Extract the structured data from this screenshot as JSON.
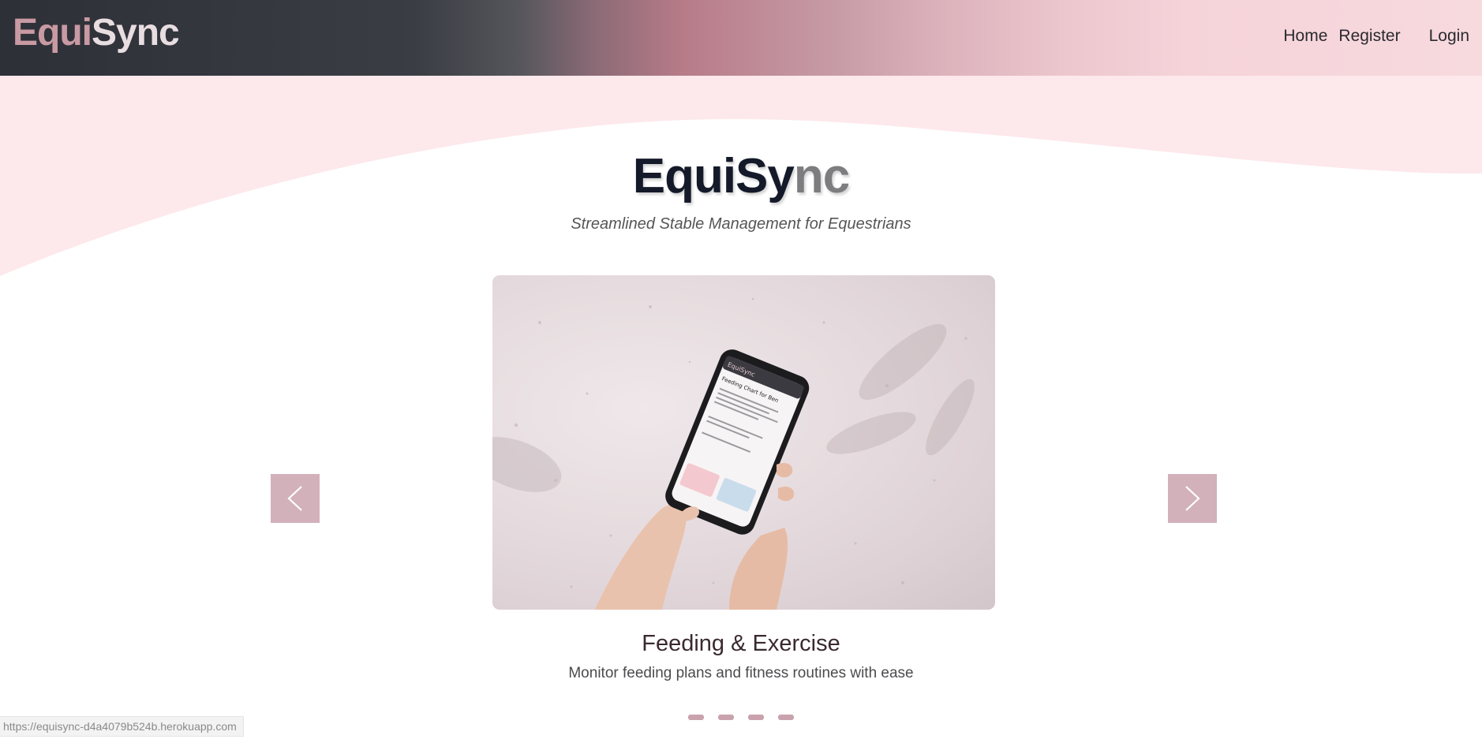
{
  "navbar": {
    "brand_part1": "Equi",
    "brand_part2": "Sync",
    "links": {
      "home": "Home",
      "register": "Register",
      "login": "Login"
    }
  },
  "hero": {
    "title_part1": "EquiSy",
    "title_part2": "nc",
    "subtitle": "Streamlined Stable Management for Equestrians"
  },
  "carousel": {
    "image_icon": "phone-in-hands-image",
    "phone_screen": {
      "brand": "EquiSync",
      "heading": "Feeding Chart for Ben"
    },
    "prev_icon": "chevron-left-icon",
    "next_icon": "chevron-right-icon",
    "slide_title": "Feeding & Exercise",
    "slide_description": "Monitor feeding plans and fitness routines with ease",
    "indicator_count": 4,
    "active_index": 0
  },
  "status_bar": {
    "url": "https://equisync-d4a4079b524b.herokuapp.com"
  },
  "colors": {
    "accent": "#d2b1bb",
    "wave": "#fde8eb",
    "nav_dark": "#2e3038",
    "nav_pink": "#f7dade"
  }
}
